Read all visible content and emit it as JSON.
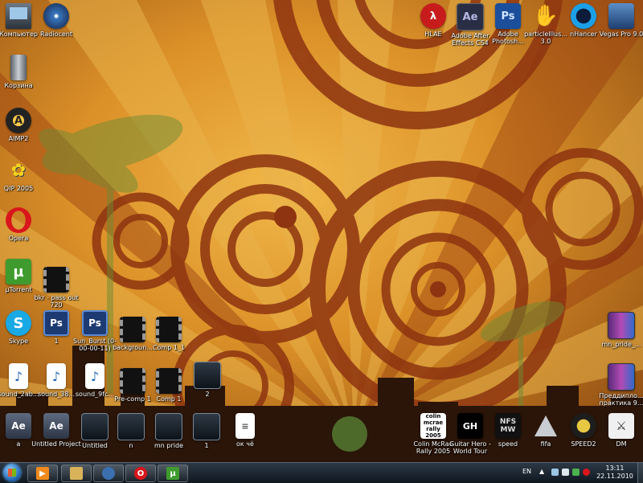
{
  "desktop": {
    "icons_left": [
      {
        "key": "computer",
        "label": "Компьютер",
        "icon": "computer-icon",
        "glyph": ""
      },
      {
        "key": "radiocent",
        "label": "Radiocent",
        "icon": "radio-disc-icon",
        "glyph": ""
      },
      {
        "key": "recycle-bin",
        "label": "Корзина",
        "icon": "recycle-bin-icon",
        "glyph": ""
      },
      {
        "key": "aimp",
        "label": "AIMP2",
        "icon": "aimp-icon",
        "glyph": "A"
      },
      {
        "key": "qip",
        "label": "QIP 2005",
        "icon": "qip-flower-icon",
        "glyph": "✿"
      },
      {
        "key": "opera",
        "label": "Opera",
        "icon": "opera-icon",
        "glyph": ""
      },
      {
        "key": "utorrent",
        "label": "µTorrent",
        "icon": "utorrent-icon",
        "glyph": "µ"
      },
      {
        "key": "bkr",
        "label": "bkr - pass out 720",
        "icon": "video-thumbnail-icon",
        "glyph": ""
      },
      {
        "key": "skype",
        "label": "Skype",
        "icon": "skype-icon",
        "glyph": "S"
      },
      {
        "key": "psd-1",
        "label": "1",
        "icon": "psd-file-icon",
        "glyph": "Ps"
      },
      {
        "key": "sunburst",
        "label": "Sun_Burst (0-00-00-11)",
        "icon": "psd-file-icon",
        "glyph": "Ps"
      },
      {
        "key": "background",
        "label": "backgroun...",
        "icon": "video-file-icon",
        "glyph": ""
      },
      {
        "key": "comp1_1",
        "label": "Comp 1_1",
        "icon": "video-file-icon",
        "glyph": ""
      },
      {
        "key": "sound1",
        "label": "sound_2ab...",
        "icon": "wav-file-icon",
        "glyph": "♪"
      },
      {
        "key": "sound2",
        "label": "sound_38...",
        "icon": "wav-file-icon",
        "glyph": "♪"
      },
      {
        "key": "sound3",
        "label": "sound_9fc...",
        "icon": "wav-file-icon",
        "glyph": "♪"
      },
      {
        "key": "precomp1",
        "label": "Pre-comp 1",
        "icon": "video-file-icon",
        "glyph": ""
      },
      {
        "key": "comp1",
        "label": "Comp 1",
        "icon": "video-file-icon",
        "glyph": ""
      },
      {
        "key": "two",
        "label": "2",
        "icon": "mpeg-file-icon",
        "glyph": ""
      },
      {
        "key": "aep-a",
        "label": "a",
        "icon": "aep-file-icon",
        "glyph": "Ae"
      },
      {
        "key": "untitled-project",
        "label": "Untitled Project",
        "icon": "aep-file-icon",
        "glyph": "Ae"
      },
      {
        "key": "untitled",
        "label": "Untitled",
        "icon": "mpeg-file-icon",
        "glyph": ""
      },
      {
        "key": "n",
        "label": "n",
        "icon": "mpeg-file-icon",
        "glyph": ""
      },
      {
        "key": "mn-pride",
        "label": "mn pride",
        "icon": "mpeg-file-icon",
        "glyph": ""
      },
      {
        "key": "one",
        "label": "1",
        "icon": "mpeg-file-icon",
        "glyph": ""
      },
      {
        "key": "ok-che",
        "label": "ок чё",
        "icon": "document-icon",
        "glyph": "≡"
      }
    ],
    "icons_top": [
      {
        "key": "hlae",
        "label": "HLAE",
        "icon": "hlae-icon",
        "glyph": "λ"
      },
      {
        "key": "ae",
        "label": "Adobe After Effects CS4",
        "icon": "after-effects-icon",
        "glyph": "Ae"
      },
      {
        "key": "ps",
        "label": "Adobe Photosh...",
        "icon": "photoshop-icon",
        "glyph": "Ps"
      },
      {
        "key": "particle",
        "label": "particleIllus... 3.0",
        "icon": "hand-icon",
        "glyph": "✋"
      },
      {
        "key": "nhancer",
        "label": "nHancer",
        "icon": "nhancer-icon",
        "glyph": ""
      },
      {
        "key": "vegas",
        "label": "Vegas Pro 9.0",
        "icon": "vegas-icon",
        "glyph": ""
      }
    ],
    "icons_right": [
      {
        "key": "mn-pride-rar",
        "label": "mn_pride_...",
        "icon": "rar-archive-icon",
        "glyph": ""
      },
      {
        "key": "praktika",
        "label": "Преддипло... практика 9...",
        "icon": "rar-archive-icon",
        "glyph": ""
      }
    ],
    "icons_bottom": [
      {
        "key": "cmr",
        "label": "Colin McRae Rally 2005",
        "icon": "colin-mcrae-icon",
        "glyph": "colin mcrae rally 2005"
      },
      {
        "key": "gh",
        "label": "Guitar Hero - World Tour",
        "icon": "guitar-hero-icon",
        "glyph": "GH"
      },
      {
        "key": "speed",
        "label": "speed",
        "icon": "nfs-most-wanted-icon",
        "glyph": "NFS MW"
      },
      {
        "key": "fifa",
        "label": "fifa",
        "icon": "fifa-icon",
        "glyph": ""
      },
      {
        "key": "speed2",
        "label": "SPEED2",
        "icon": "speed2-icon",
        "glyph": ""
      },
      {
        "key": "dm",
        "label": "DM",
        "icon": "dm-icon",
        "glyph": "⚔"
      }
    ]
  },
  "taskbar": {
    "items": [
      {
        "key": "start",
        "icon": "windows-start-icon",
        "glyph": "",
        "color": "#3a8ee6"
      },
      {
        "key": "media",
        "icon": "media-player-icon",
        "glyph": "▶",
        "color": "#f08a1c"
      },
      {
        "key": "explorer",
        "icon": "folder-icon",
        "glyph": "",
        "color": "#d9b35a"
      },
      {
        "key": "vegas",
        "icon": "vegas-icon",
        "glyph": "",
        "color": "#3b6fb0"
      },
      {
        "key": "opera",
        "icon": "opera-icon",
        "glyph": "O",
        "color": "#d8161c"
      },
      {
        "key": "utorrent",
        "icon": "utorrent-icon",
        "glyph": "µ",
        "color": "#3f9b2e"
      }
    ],
    "tray": {
      "language": "EN",
      "time": "13:11",
      "date": "22.11.2010"
    }
  }
}
